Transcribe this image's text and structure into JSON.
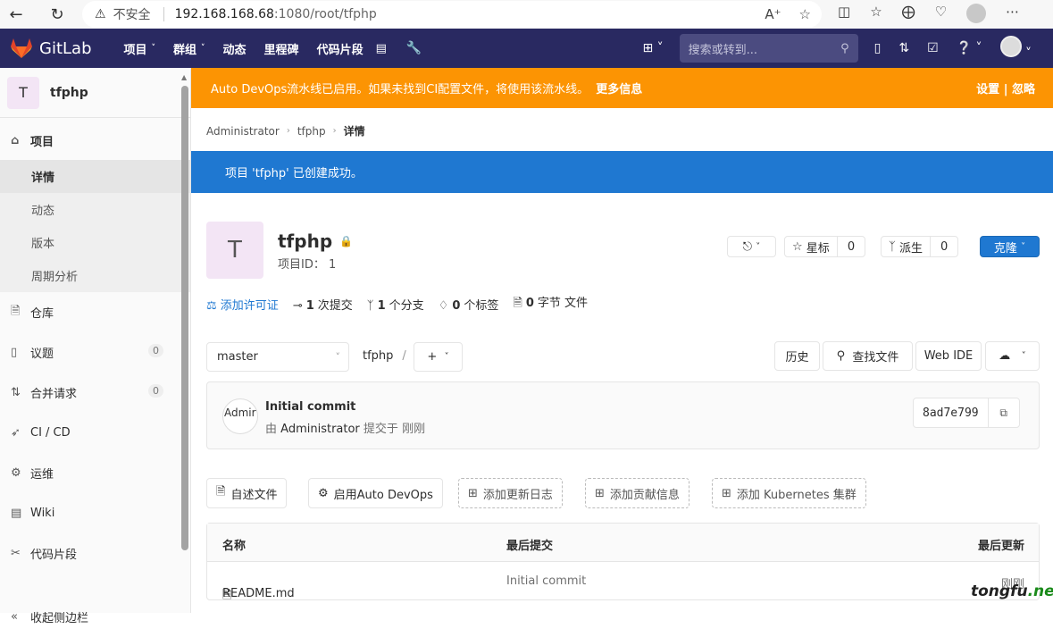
{
  "browser": {
    "insecure_label": "不安全",
    "url_host": "192.168.168.68",
    "url_path": ":1080/root/tfphp"
  },
  "gitlab_nav": {
    "logo_text": "GitLab",
    "menu": [
      {
        "label": "项目",
        "has_caret": true
      },
      {
        "label": "群组",
        "has_caret": true
      },
      {
        "label": "动态",
        "has_caret": false
      },
      {
        "label": "里程碑",
        "has_caret": false
      },
      {
        "label": "代码片段",
        "has_caret": false
      }
    ],
    "search_placeholder": "搜索或转到..."
  },
  "sidebar": {
    "project_initial": "T",
    "project_name": "tfphp",
    "section_project": "项目",
    "sub_items": [
      "详情",
      "动态",
      "版本",
      "周期分析"
    ],
    "items": [
      {
        "label": "仓库",
        "icon": "doc-icon"
      },
      {
        "label": "议题",
        "icon": "issues-icon",
        "count": "0"
      },
      {
        "label": "合并请求",
        "icon": "merge-request-icon",
        "count": "0"
      },
      {
        "label": "CI / CD",
        "icon": "rocket-icon"
      },
      {
        "label": "运维",
        "icon": "operations-icon"
      },
      {
        "label": "Wiki",
        "icon": "book-icon"
      },
      {
        "label": "代码片段",
        "icon": "scissors-icon"
      }
    ],
    "collapse_label": "收起侧边栏"
  },
  "banner": {
    "autodevops_text": "Auto DevOps流水线已启用。如果未找到CI配置文件，将使用该流水线。",
    "more_info": "更多信息",
    "settings": "设置",
    "separator": "|",
    "dismiss": "忽略"
  },
  "breadcrumb": [
    "Administrator",
    "tfphp",
    "详情"
  ],
  "flash": "项目 'tfphp' 已创建成功。",
  "project": {
    "initial": "T",
    "name": "tfphp",
    "id_label": "项目ID：",
    "id_value": "1",
    "star_label": "星标",
    "star_count": "0",
    "fork_label": "派生",
    "fork_count": "0",
    "clone_label": "克隆"
  },
  "stats": {
    "license": "添加许可证",
    "commits_count": "1",
    "commits_label": "次提交",
    "branches_count": "1",
    "branches_label": "个分支",
    "tags_count": "0",
    "tags_label": "个标签",
    "size_count": "0",
    "size_label": "字节 文件"
  },
  "repo": {
    "branch": "master",
    "path": "tfphp",
    "path_sep": "/",
    "history": "历史",
    "find_file": "查找文件",
    "web_ide": "Web IDE"
  },
  "commit": {
    "avatar_alt": "Admir",
    "title": "Initial commit",
    "by": "由",
    "author": "Administrator",
    "committed": "提交于",
    "time": "刚刚",
    "sha": "8ad7e799"
  },
  "quick_actions": [
    {
      "label": "自述文件",
      "style": "solid",
      "icon": "doc-icon"
    },
    {
      "label": "启用Auto DevOps",
      "style": "solid",
      "icon": "gear-icon"
    },
    {
      "label": "添加更新日志",
      "style": "dashed",
      "icon": "plus-square-icon"
    },
    {
      "label": "添加贡献信息",
      "style": "dashed",
      "icon": "plus-square-icon"
    },
    {
      "label": "添加 Kubernetes 集群",
      "style": "dashed",
      "icon": "plus-square-icon"
    }
  ],
  "file_table": {
    "headers": [
      "名称",
      "最后提交",
      "最后更新"
    ],
    "rows": [
      {
        "name": "README.md",
        "commit": "Initial commit",
        "updated": "刚刚"
      }
    ]
  },
  "watermark": {
    "left": "tongfu",
    "right": ".net"
  }
}
